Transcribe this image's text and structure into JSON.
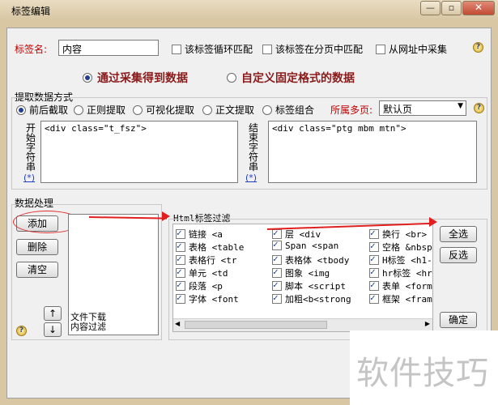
{
  "window": {
    "title": "标签编辑"
  },
  "titlebar": {
    "minimize": "—",
    "maximize": "▫",
    "close": "✕"
  },
  "tag": {
    "name_label": "标签名:",
    "name_value": "内容",
    "loop_match": "该标签循环匹配",
    "page_match": "该标签在分页中匹配",
    "from_url": "从网址中采集"
  },
  "mode": {
    "option1": "通过采集得到数据",
    "option2": "自定义固定格式的数据"
  },
  "extract": {
    "section_title": "提取数据方式",
    "methods": [
      "前后截取",
      "正则提取",
      "可视化提取",
      "正文提取",
      "标签组合"
    ],
    "page_label": "所属多页:",
    "page_value": "默认页",
    "start_label": "开始字符串",
    "start_value": "<div class=\"t_fsz\">",
    "end_label": "结束字符串",
    "end_value": "<div class=\"ptg mbm mtn\">",
    "star": "(*)"
  },
  "processing": {
    "section_title": "数据处理",
    "add": "添加",
    "delete": "删除",
    "clear": "清空",
    "up": "↑",
    "down": "↓",
    "items": [
      "文件下载",
      "内容过滤"
    ]
  },
  "html_filter": {
    "title": "Html标签过滤",
    "col1": [
      "链接 <a",
      "表格 <table",
      "表格行 <tr",
      "单元 <td",
      "段落 <p",
      "字体 <font"
    ],
    "col2": [
      "层 <div",
      "Span <span",
      "表格体 <tbody",
      "图象 <img",
      "脚本 <script",
      "加粗<b<strong"
    ],
    "col3": [
      "换行 <br>",
      "空格 &nbsp",
      "H标签 <h1-",
      "hr标签 <hr",
      "表单 <form",
      "框架 <fram"
    ],
    "select_all": "全选",
    "invert": "反选",
    "confirm": "确定"
  },
  "watermark": "软件技巧"
}
